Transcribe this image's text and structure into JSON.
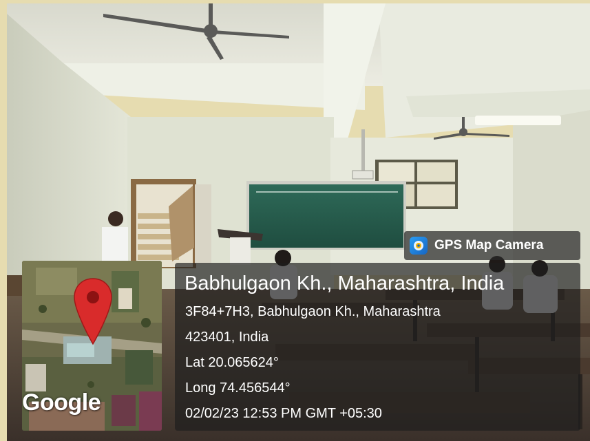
{
  "badge": {
    "label": "GPS Map Camera",
    "icon": "gps-map-camera-icon"
  },
  "map": {
    "logo_text": "Google",
    "marker_icon": "location-pin-icon",
    "marker_color": "#d92b2b"
  },
  "location": {
    "title": "Babhulgaon Kh., Maharashtra, India",
    "address_line1": "3F84+7H3, Babhulgaon Kh., Maharashtra",
    "address_line2": "423401, India",
    "lat": "Lat 20.065624°",
    "long": "Long 74.456544°",
    "datetime": "02/02/23 12:53 PM GMT +05:30"
  }
}
